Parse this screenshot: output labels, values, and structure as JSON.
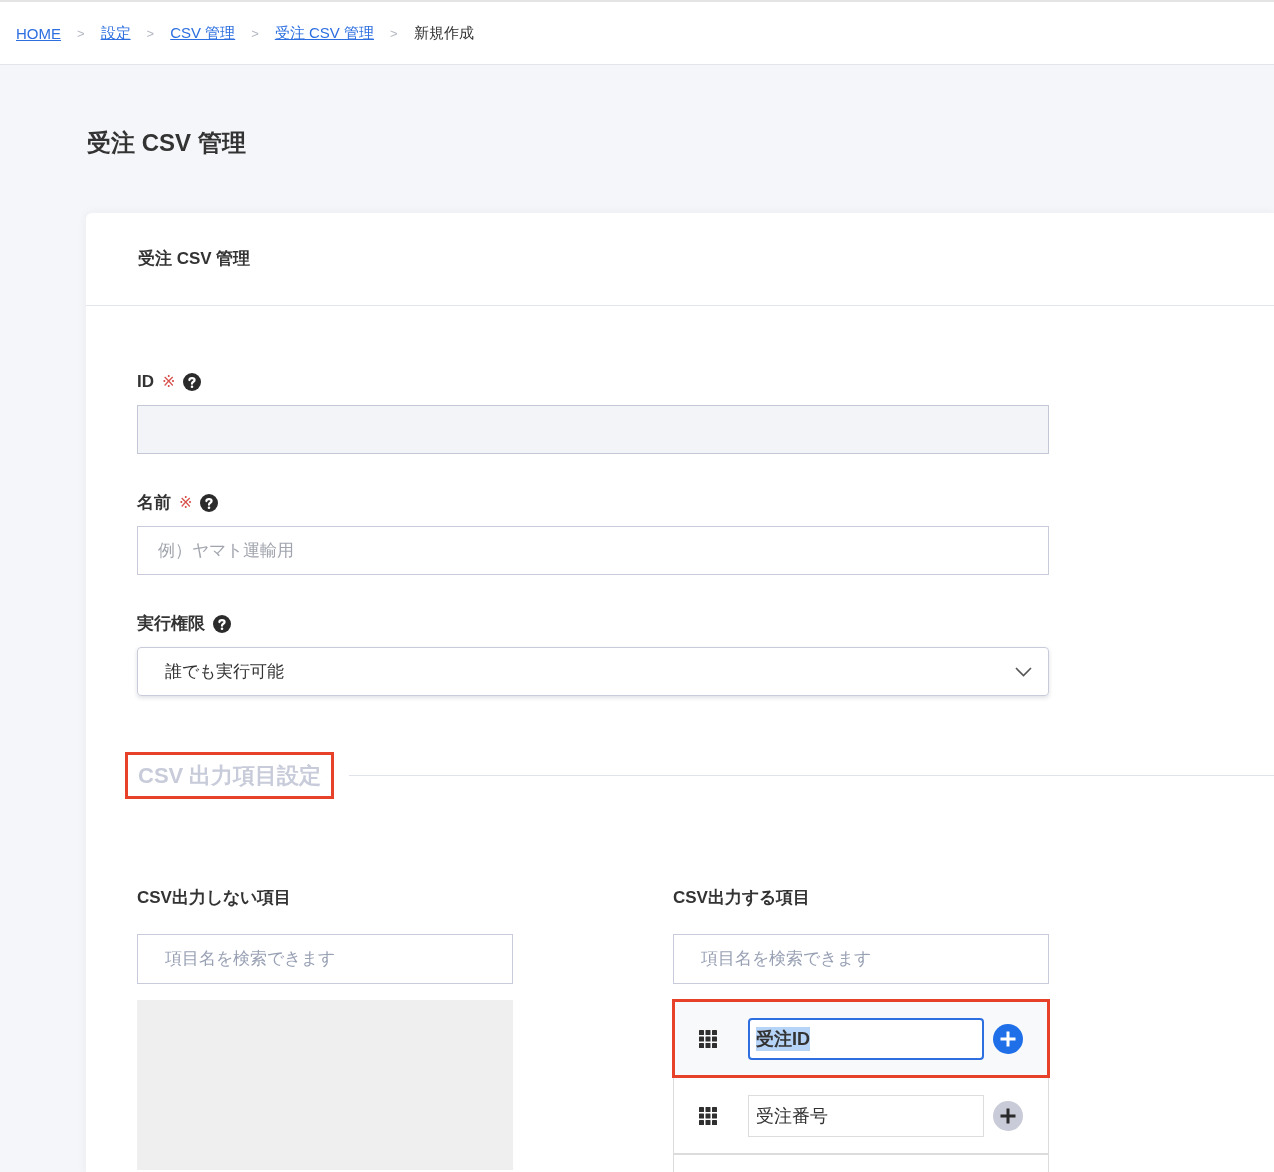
{
  "breadcrumb": [
    {
      "label": "HOME",
      "link": true
    },
    {
      "separator": ">",
      "label": "設定",
      "link": true
    },
    {
      "separator": ">",
      "label": "CSV 管理",
      "link": true
    },
    {
      "separator": ">",
      "label": "受注 CSV 管理",
      "link": true
    },
    {
      "separator": ">",
      "label": "新規作成",
      "link": false
    }
  ],
  "page_title": "受注 CSV 管理",
  "card": {
    "title": "受注 CSV 管理",
    "fields": [
      {
        "kind": "text",
        "label": "ID",
        "required_mark": "※",
        "help": true,
        "disabled": true
      },
      {
        "kind": "text",
        "label": "名前",
        "required_mark": "※",
        "help": true,
        "disabled": false,
        "placeholder": "例）ヤマト運輸用"
      },
      {
        "kind": "select",
        "label": "実行権限",
        "help": true,
        "value": "誰でも実行可能"
      }
    ],
    "section": {
      "title": "CSV 出力項目設定",
      "highlighted": true
    },
    "columns": [
      {
        "kind": "empty",
        "title": "CSV出力しない項目",
        "search": {
          "placeholder": "項目名を検索できます"
        }
      },
      {
        "kind": "list",
        "title": "CSV出力する項目",
        "search": {
          "placeholder": "項目名を検索できます"
        },
        "items": [
          {
            "name": "受注ID",
            "highlighted": true,
            "focused": true,
            "text_selected": true
          },
          {
            "name": "受注番号",
            "highlighted": false,
            "focused": false,
            "text_selected": false
          }
        ]
      }
    ]
  }
}
